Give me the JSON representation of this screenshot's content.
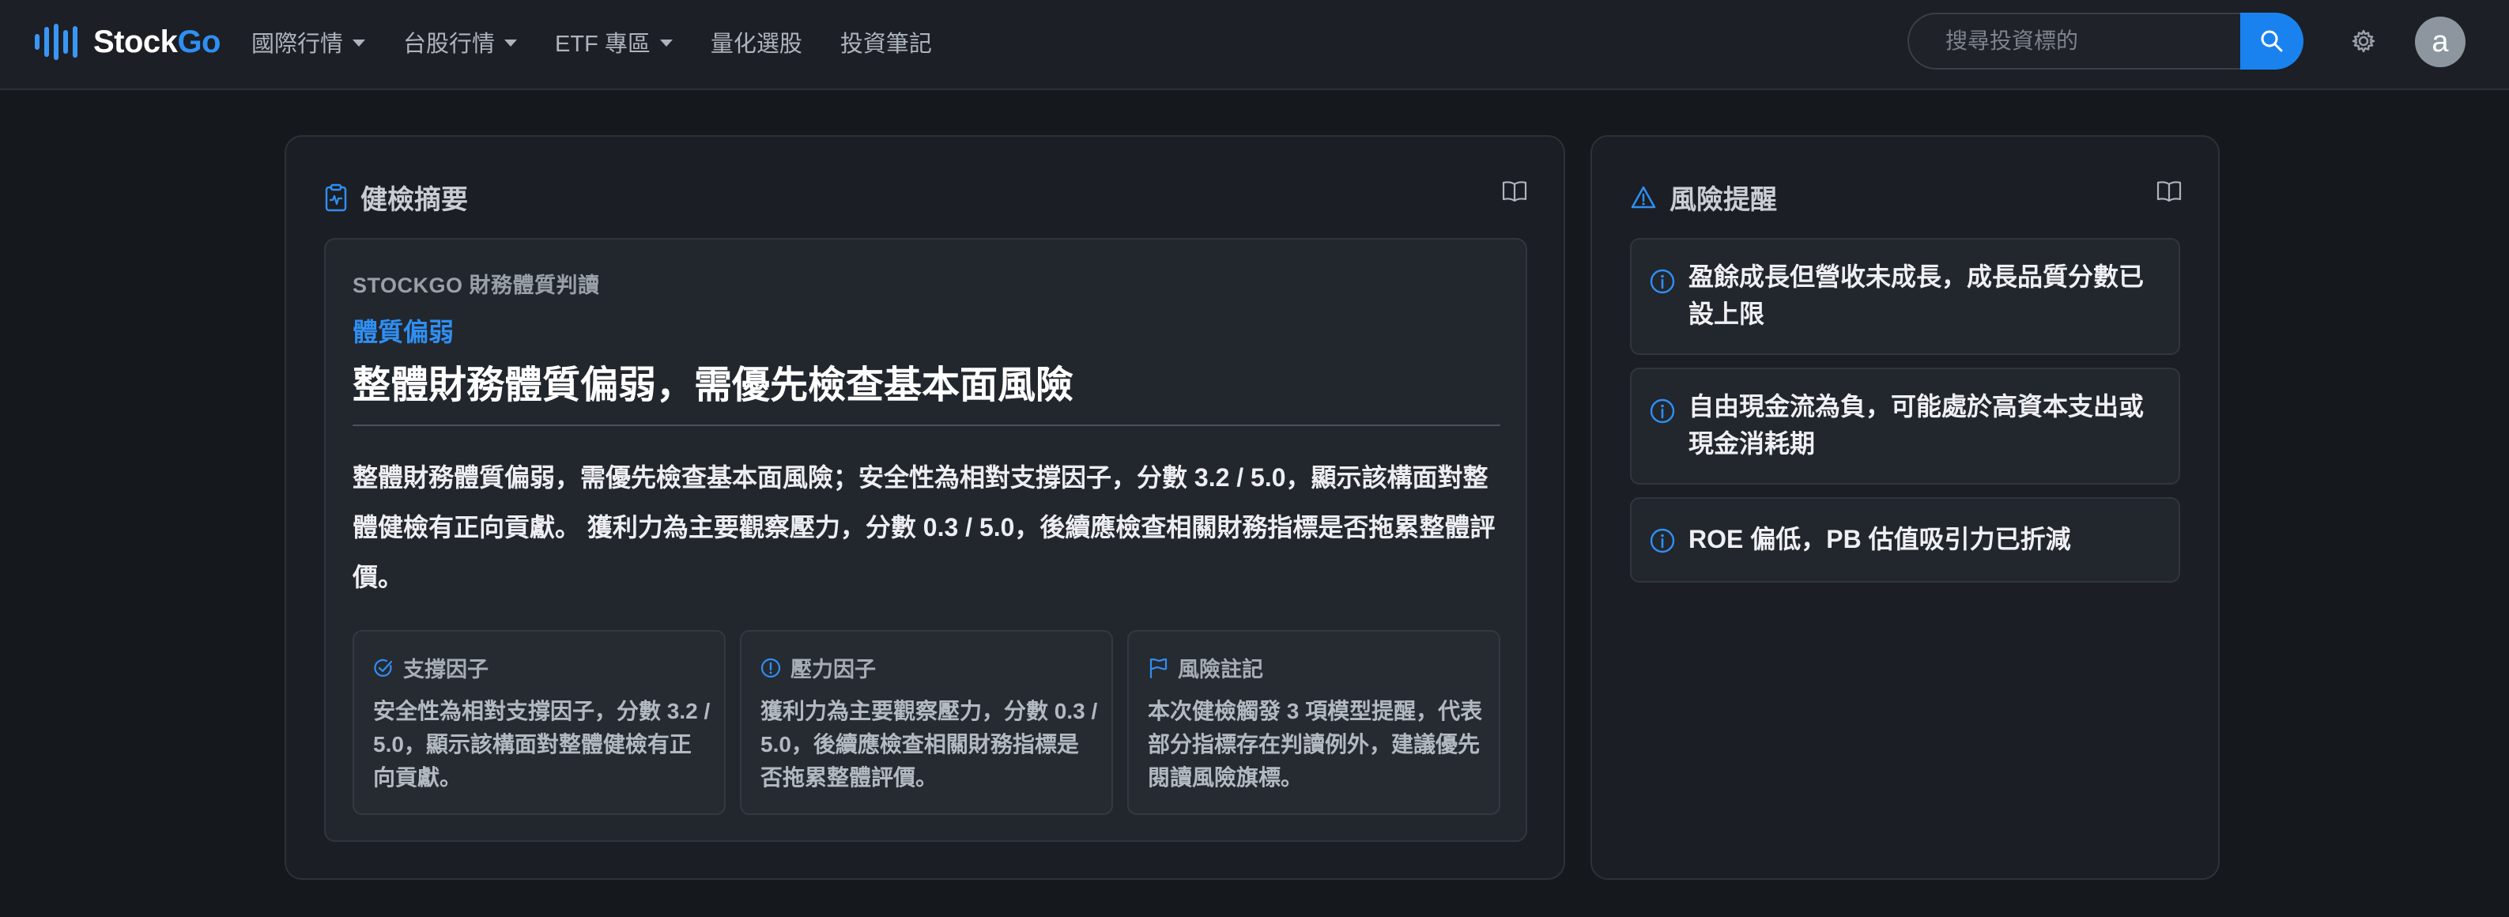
{
  "brand": {
    "name_part1": "Stock",
    "name_part2": "Go"
  },
  "nav": {
    "items": [
      {
        "label": "國際行情",
        "has_dropdown": true
      },
      {
        "label": "台股行情",
        "has_dropdown": true
      },
      {
        "label": "ETF 專區",
        "has_dropdown": true
      },
      {
        "label": "量化選股",
        "has_dropdown": false
      },
      {
        "label": "投資筆記",
        "has_dropdown": false
      }
    ]
  },
  "search": {
    "placeholder": "搜尋投資標的",
    "value": ""
  },
  "user": {
    "avatar_letter": "a"
  },
  "health": {
    "title": "健檢摘要",
    "eyebrow": "STOCKGO 財務體質判讀",
    "tag": "體質偏弱",
    "headline": "整體財務體質偏弱，需優先檢查基本面風險",
    "summary": "整體財務體質偏弱，需優先檢查基本面風險；安全性為相對支撐因子，分數 3.2 / 5.0，顯示該構面對整體健檢有正向貢獻。 獲利力為主要觀察壓力，分數 0.3 / 5.0，後續應檢查相關財務指標是否拖累整體評價。",
    "factors": [
      {
        "label": "支撐因子",
        "body": "安全性為相對支撐因子，分數 3.2 / 5.0，顯示該構面對整體健檢有正向貢獻。"
      },
      {
        "label": "壓力因子",
        "body": "獲利力為主要觀察壓力，分數 0.3 / 5.0，後續應檢查相關財務指標是否拖累整體評價。"
      },
      {
        "label": "風險註記",
        "body": "本次健檢觸發 3 項模型提醒，代表部分指標存在判讀例外，建議優先閱讀風險旗標。"
      }
    ]
  },
  "risk": {
    "title": "風險提醒",
    "alerts": [
      {
        "text": "盈餘成長但營收未成長，成長品質分數已設上限"
      },
      {
        "text": "自由現金流為負，可能處於高資本支出或現金消耗期"
      },
      {
        "text": "ROE 偏低，PB 估值吸引力已折減"
      }
    ]
  },
  "colors": {
    "accent": "#2f8ff2",
    "background": "#15181d",
    "card": "#1b1e24",
    "search_button": "#1a82ef"
  },
  "icons": [
    "stockgo-logo-icon",
    "search-icon",
    "gear-icon",
    "clipboard-pulse-icon",
    "book-icon",
    "warning-triangle-icon",
    "check-circle-icon",
    "exclamation-circle-icon",
    "flag-icon",
    "info-circle-icon"
  ]
}
